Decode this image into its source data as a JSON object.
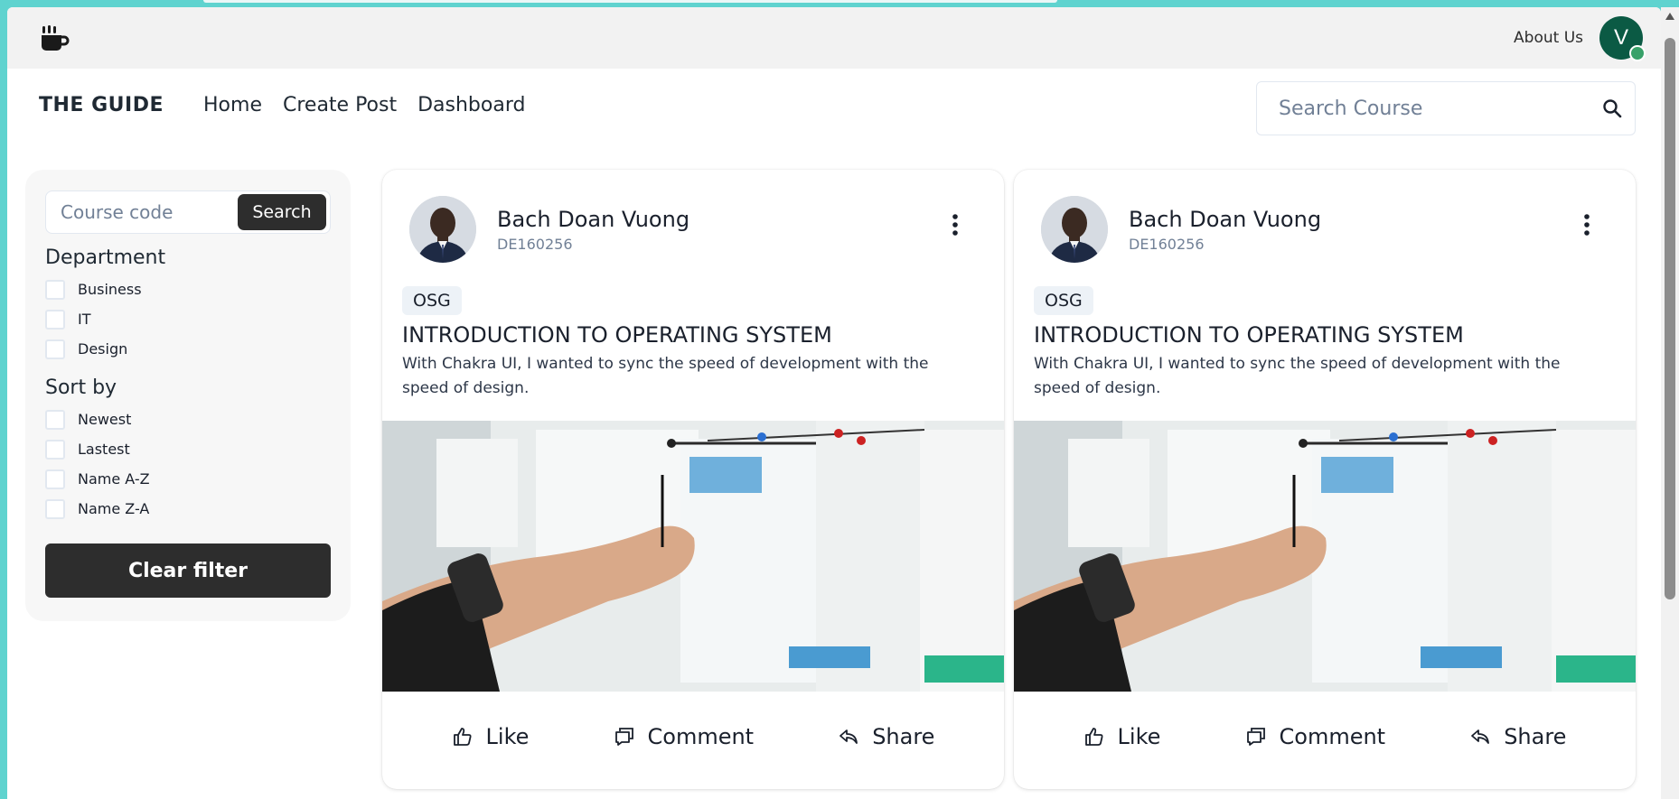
{
  "topbar": {
    "about_label": "About Us",
    "avatar_initial": "V",
    "avatar_color": "#0b5a44",
    "status_color": "#38a169"
  },
  "nav": {
    "brand": "THE GUIDE",
    "links": [
      "Home",
      "Create Post",
      "Dashboard"
    ],
    "search_placeholder": "Search Course"
  },
  "sidebar": {
    "code_placeholder": "Course code",
    "search_label": "Search",
    "department_heading": "Department",
    "departments": [
      "Business",
      "IT",
      "Design"
    ],
    "sort_heading": "Sort by",
    "sort_options": [
      "Newest",
      "Lastest",
      "Name A-Z",
      "Name Z-A"
    ],
    "clear_label": "Clear filter"
  },
  "posts": [
    {
      "author": "Bach Doan Vuong",
      "author_id": "DE160256",
      "tag": "OSG",
      "title": "INTRODUCTION TO OPERATING SYSTEM",
      "description": "With Chakra UI, I wanted to sync the speed of development with the speed of design.",
      "like_label": "Like",
      "comment_label": "Comment",
      "share_label": "Share"
    },
    {
      "author": "Bach Doan Vuong",
      "author_id": "DE160256",
      "tag": "OSG",
      "title": "INTRODUCTION TO OPERATING SYSTEM",
      "description": "With Chakra UI, I wanted to sync the speed of development with the speed of design.",
      "like_label": "Like",
      "comment_label": "Comment",
      "share_label": "Share"
    }
  ]
}
